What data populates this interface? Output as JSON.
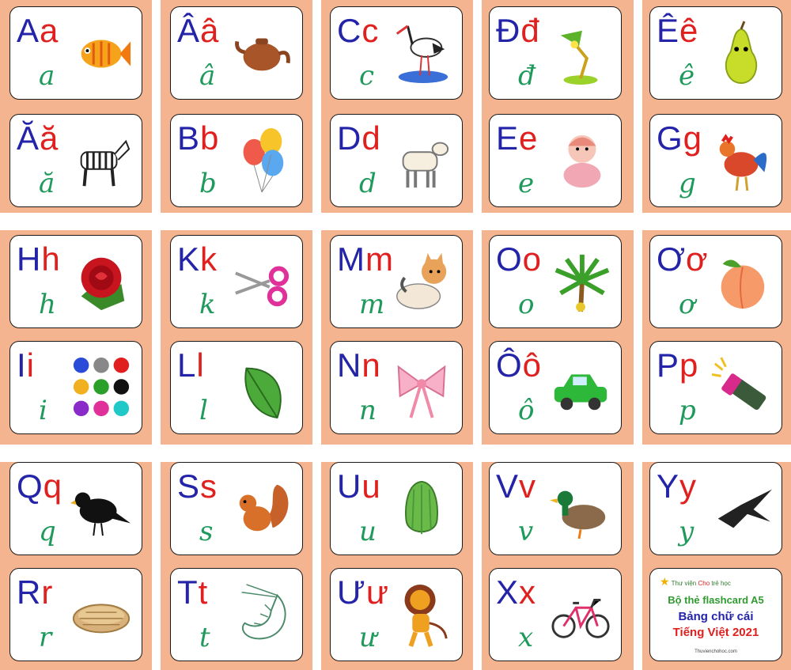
{
  "cards": [
    {
      "upper": "A",
      "lower": "a",
      "cursive": "a",
      "icon": "fish-icon"
    },
    {
      "upper": "Â",
      "lower": "â",
      "cursive": "â",
      "icon": "teapot-icon"
    },
    {
      "upper": "C",
      "lower": "c",
      "cursive": "c",
      "icon": "stork-icon"
    },
    {
      "upper": "Đ",
      "lower": "đ",
      "cursive": "đ",
      "icon": "lamp-icon"
    },
    {
      "upper": "Ê",
      "lower": "ê",
      "cursive": "ê",
      "icon": "pear-icon"
    },
    {
      "upper": "Ă",
      "lower": "ă",
      "cursive": "ă",
      "icon": "zebra-icon"
    },
    {
      "upper": "B",
      "lower": "b",
      "cursive": "b",
      "icon": "balloons-icon"
    },
    {
      "upper": "D",
      "lower": "d",
      "cursive": "d",
      "icon": "goat-icon"
    },
    {
      "upper": "E",
      "lower": "e",
      "cursive": "e",
      "icon": "baby-icon"
    },
    {
      "upper": "G",
      "lower": "g",
      "cursive": "g",
      "icon": "rooster-icon"
    },
    {
      "upper": "H",
      "lower": "h",
      "cursive": "h",
      "icon": "rose-icon"
    },
    {
      "upper": "K",
      "lower": "k",
      "cursive": "k",
      "icon": "scissors-icon"
    },
    {
      "upper": "M",
      "lower": "m",
      "cursive": "m",
      "icon": "cat-icon"
    },
    {
      "upper": "O",
      "lower": "o",
      "cursive": "o",
      "icon": "palm-tree-icon"
    },
    {
      "upper": "Ơ",
      "lower": "ơ",
      "cursive": "ơ",
      "icon": "peach-icon"
    },
    {
      "upper": "I",
      "lower": "i",
      "cursive": "i",
      "icon": "color-dots-icon"
    },
    {
      "upper": "L",
      "lower": "l",
      "cursive": "l",
      "icon": "leaf-icon"
    },
    {
      "upper": "N",
      "lower": "n",
      "cursive": "n",
      "icon": "bow-icon"
    },
    {
      "upper": "Ô",
      "lower": "ô",
      "cursive": "ô",
      "icon": "car-icon"
    },
    {
      "upper": "P",
      "lower": "p",
      "cursive": "p",
      "icon": "flashlight-icon"
    },
    {
      "upper": "Q",
      "lower": "q",
      "cursive": "q",
      "icon": "crow-icon"
    },
    {
      "upper": "S",
      "lower": "s",
      "cursive": "s",
      "icon": "squirrel-icon"
    },
    {
      "upper": "U",
      "lower": "u",
      "cursive": "u",
      "icon": "papaya-icon"
    },
    {
      "upper": "V",
      "lower": "v",
      "cursive": "v",
      "icon": "duck-icon"
    },
    {
      "upper": "Y",
      "lower": "y",
      "cursive": "y",
      "icon": "swallow-icon"
    },
    {
      "upper": "R",
      "lower": "r",
      "cursive": "r",
      "icon": "basket-icon"
    },
    {
      "upper": "T",
      "lower": "t",
      "cursive": "t",
      "icon": "shrimp-icon"
    },
    {
      "upper": "Ư",
      "lower": "ư",
      "cursive": "ư",
      "icon": "lion-icon"
    },
    {
      "upper": "X",
      "lower": "x",
      "cursive": "x",
      "icon": "bicycle-icon"
    }
  ],
  "cover": {
    "logo_text_1": "Thư viện",
    "logo_text_2": "Cho",
    "logo_text_3": "trẻ học",
    "line1": "Bộ thẻ flashcard A5",
    "line2": "Bảng chữ cái",
    "line3": "Tiếng Việt 2021",
    "url": "Thuvienchohoc.com"
  },
  "colors": {
    "background_orange": "#f4b48f",
    "uppercase_blue": "#2424a8",
    "lowercase_red": "#e0201e",
    "cursive_green": "#1f9a5c"
  }
}
